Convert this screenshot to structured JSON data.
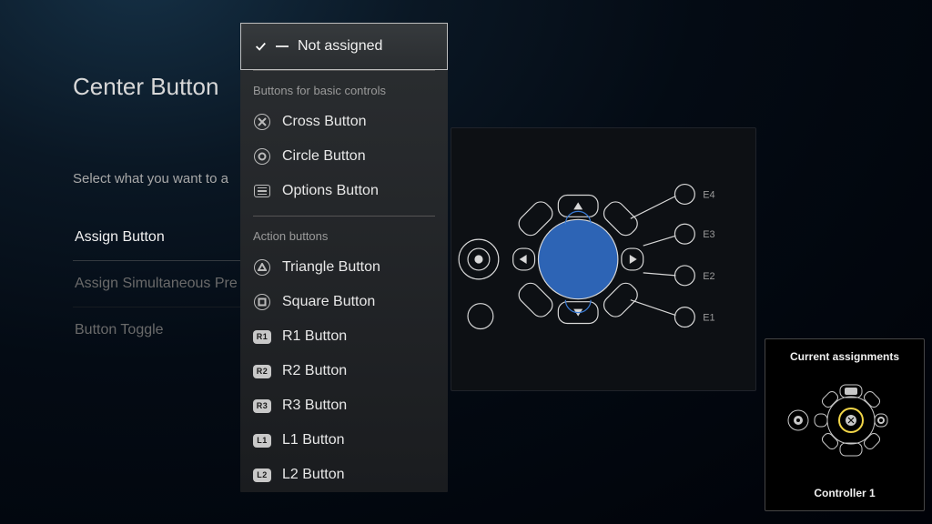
{
  "title": "Center Button",
  "instruction": "Select what you want to a",
  "left_menu": {
    "items": [
      {
        "label": "Assign Button",
        "active": true
      },
      {
        "label": "Assign Simultaneous Pre",
        "active": false
      },
      {
        "label": "Button Toggle",
        "active": false
      }
    ]
  },
  "dropdown": {
    "selected": "Not assigned",
    "sections": [
      {
        "heading": "Buttons for basic controls",
        "items": [
          {
            "icon": "cross",
            "label": "Cross Button"
          },
          {
            "icon": "circle",
            "label": "Circle Button"
          },
          {
            "icon": "options",
            "label": "Options Button"
          }
        ]
      },
      {
        "heading": "Action buttons",
        "items": [
          {
            "icon": "triangle",
            "label": "Triangle Button"
          },
          {
            "icon": "square",
            "label": "Square Button"
          },
          {
            "icon": "pill",
            "pill": "R1",
            "label": "R1 Button"
          },
          {
            "icon": "pill",
            "pill": "R2",
            "label": "R2 Button"
          },
          {
            "icon": "pill",
            "pill": "R3",
            "label": "R3 Button"
          },
          {
            "icon": "pill",
            "pill": "L1",
            "label": "L1 Button"
          },
          {
            "icon": "pill",
            "pill": "L2",
            "label": "L2 Button"
          }
        ]
      }
    ]
  },
  "diagram": {
    "ports": [
      "E4",
      "E3",
      "E2",
      "E1"
    ]
  },
  "assignments": {
    "title": "Current assignments",
    "controller": "Controller 1"
  }
}
